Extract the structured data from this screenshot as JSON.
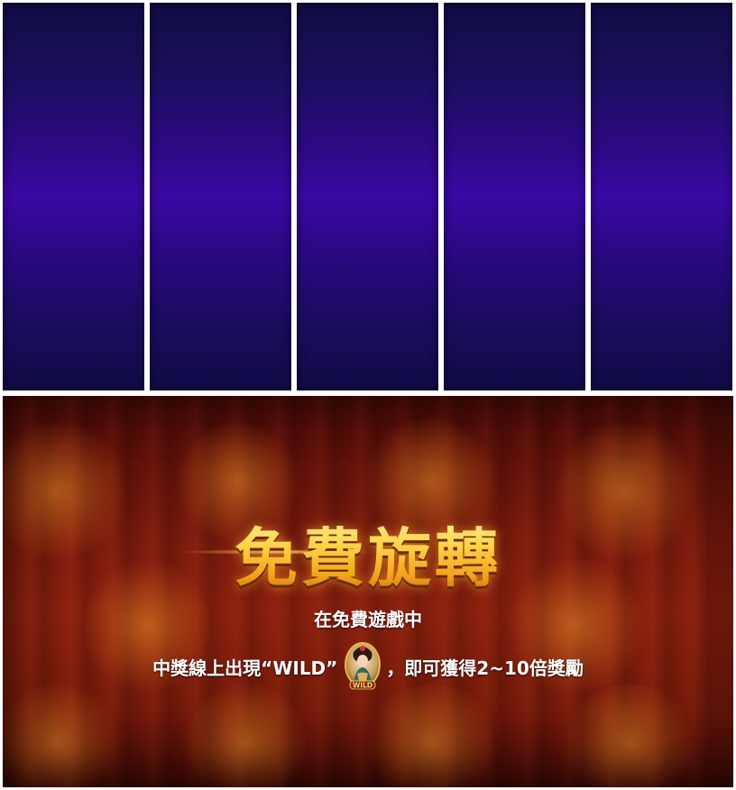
{
  "reels": {
    "count": 5,
    "colors": {
      "top": "#110c45",
      "middle": "#3a08a4",
      "bottom": "#100b45"
    }
  },
  "free_spins_panel": {
    "title": "免費旋轉",
    "line1": "在免費遊戲中",
    "line2_prefix": "中獎線上出現“WILD”",
    "line2_suffix": "，即可獲得2~10倍獎勵",
    "wild_symbol": {
      "icon": "wild-lady-icon",
      "label": "WILD"
    },
    "colors": {
      "background": "#7a1a0c",
      "title_gold": "#ffd54a",
      "text": "#ffffff"
    }
  }
}
